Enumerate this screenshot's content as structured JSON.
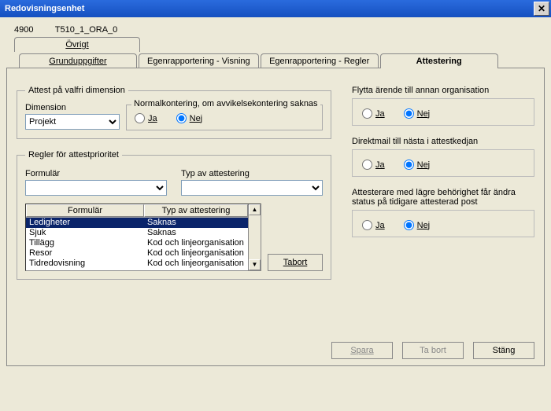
{
  "window": {
    "title": "Redovisningsenhet",
    "close_label": "✕"
  },
  "header": {
    "code": "4900",
    "name": "T510_1_ORA_0"
  },
  "tabs": {
    "row1": {
      "ovrigt": "Övrigt"
    },
    "row2": {
      "grund": "Grunduppgifter",
      "egen_v": "Egenrapportering - Visning",
      "egen_r": "Egenrapportering - Regler",
      "attest": "Attestering"
    }
  },
  "attest_dim": {
    "legend": "Attest på valfri dimension",
    "label": "Dimension",
    "value": "Projekt",
    "normal_legend": "Normalkontering, om avvikelsekontering saknas",
    "ja": "Ja",
    "nej": "Nej"
  },
  "regler": {
    "legend": "Regler för attestprioritet",
    "form_label": "Formulär",
    "form_value": "",
    "typ_label": "Typ av attestering",
    "typ_value": "",
    "header_form": "Formulär",
    "header_typ": "Typ av attestering",
    "rows": [
      {
        "form": "Ledigheter",
        "typ": "Saknas",
        "selected": true
      },
      {
        "form": "Sjuk",
        "typ": "Saknas",
        "selected": false
      },
      {
        "form": "Tillägg",
        "typ": "Kod och linjeorganisation",
        "selected": false
      },
      {
        "form": "Resor",
        "typ": "Kod och linjeorganisation",
        "selected": false
      },
      {
        "form": "Tidredovisning",
        "typ": "Kod och linjeorganisation",
        "selected": false
      }
    ],
    "tabort": "Tabort"
  },
  "right": {
    "flytta_label": "Flytta ärende till annan organisation",
    "direkt_label": "Direktmail till nästa i attestkedjan",
    "lagre_label": "Attesterare med lägre behörighet får ändra status på tidigare attesterad post",
    "ja": "Ja",
    "nej": "Nej"
  },
  "footer": {
    "spara": "Spara",
    "tabort": "Ta bort",
    "stang": "Stäng"
  }
}
